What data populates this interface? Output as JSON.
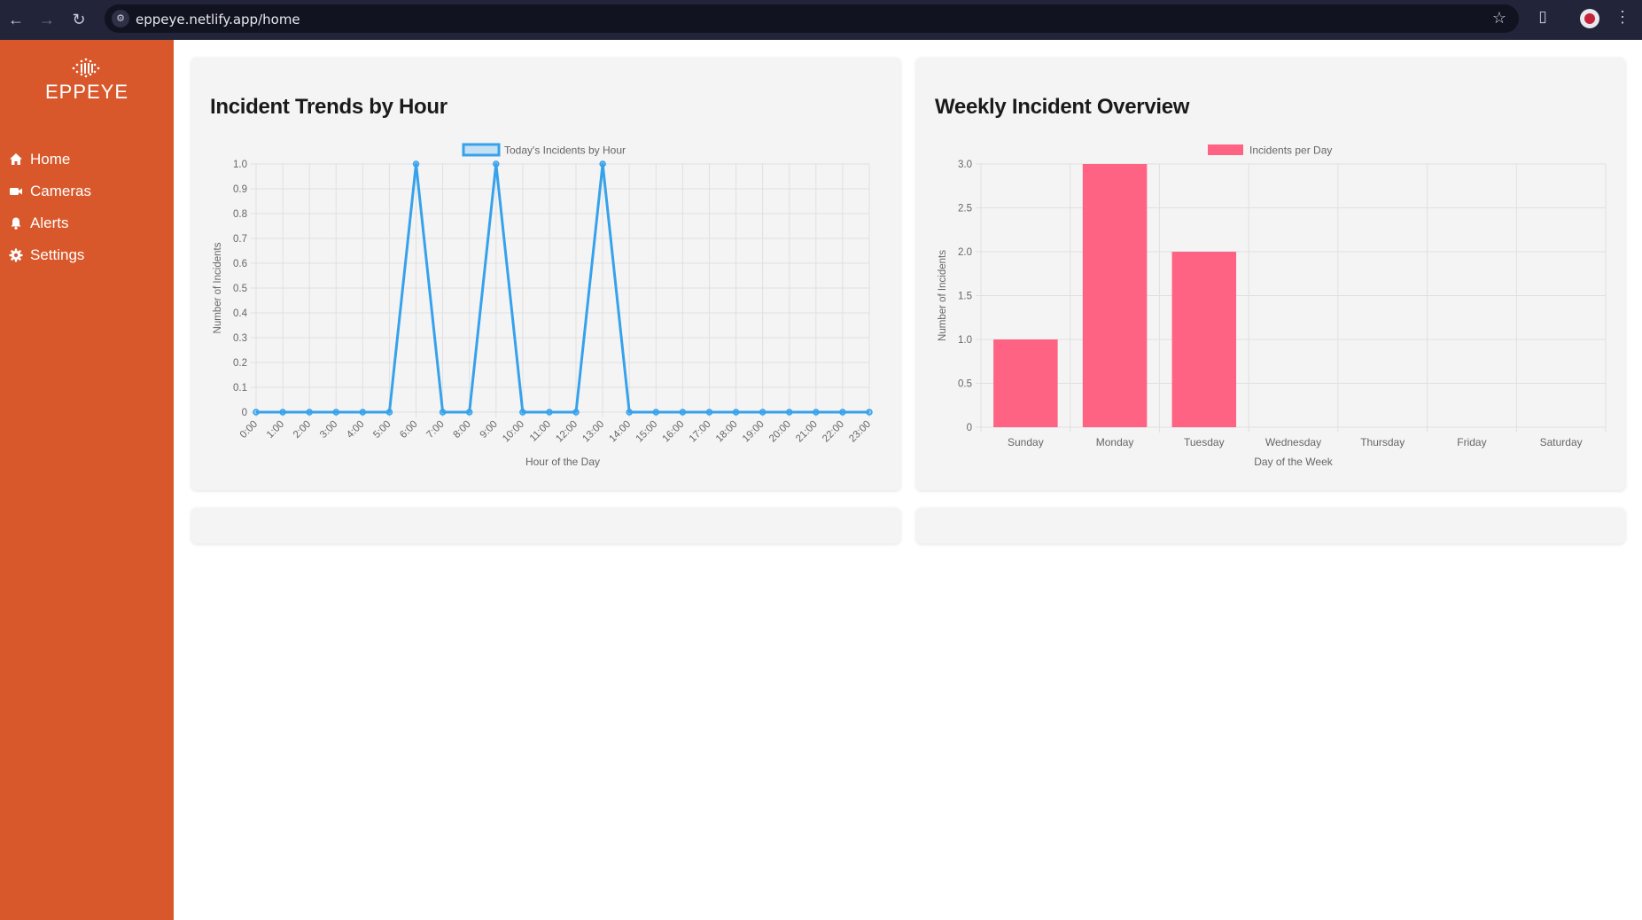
{
  "browser": {
    "url": "eppeye.netlify.app/home"
  },
  "sidebar": {
    "brand": "EPPEYE",
    "items": [
      {
        "label": "Home",
        "icon": "home-icon"
      },
      {
        "label": "Cameras",
        "icon": "camera-icon"
      },
      {
        "label": "Alerts",
        "icon": "bell-icon"
      },
      {
        "label": "Settings",
        "icon": "gear-icon"
      }
    ]
  },
  "colors": {
    "sidebar": "#d9582b",
    "line_series": "#36a2eb",
    "bar_series": "#ff6384"
  },
  "cards": {
    "hourly_title": "Incident Trends by Hour",
    "weekly_title": "Weekly Incident Overview"
  },
  "chart_data": [
    {
      "type": "line",
      "title": "Incident Trends by Hour",
      "legend": "Today's Incidents by Hour",
      "legend_position": "top",
      "xlabel": "Hour of the Day",
      "ylabel": "Number of Incidents",
      "categories": [
        "0:00",
        "1:00",
        "2:00",
        "3:00",
        "4:00",
        "5:00",
        "6:00",
        "7:00",
        "8:00",
        "9:00",
        "10:00",
        "11:00",
        "12:00",
        "13:00",
        "14:00",
        "15:00",
        "16:00",
        "17:00",
        "18:00",
        "19:00",
        "20:00",
        "21:00",
        "22:00",
        "23:00"
      ],
      "series": [
        {
          "name": "Today's Incidents by Hour",
          "values": [
            0,
            0,
            0,
            0,
            0,
            0,
            1,
            0,
            0,
            1,
            0,
            0,
            0,
            1,
            0,
            0,
            0,
            0,
            0,
            0,
            0,
            0,
            0,
            0
          ]
        }
      ],
      "ylim": [
        0,
        1
      ],
      "yticks": [
        "0",
        "0.1",
        "0.2",
        "0.3",
        "0.4",
        "0.5",
        "0.6",
        "0.7",
        "0.8",
        "0.9",
        "1.0"
      ],
      "grid": true
    },
    {
      "type": "bar",
      "title": "Weekly Incident Overview",
      "legend": "Incidents per Day",
      "legend_position": "top",
      "xlabel": "Day of the Week",
      "ylabel": "Number of Incidents",
      "categories": [
        "Sunday",
        "Monday",
        "Tuesday",
        "Wednesday",
        "Thursday",
        "Friday",
        "Saturday"
      ],
      "series": [
        {
          "name": "Incidents per Day",
          "values": [
            1,
            3,
            2,
            0,
            0,
            0,
            0
          ]
        }
      ],
      "ylim": [
        0,
        3
      ],
      "yticks": [
        "0",
        "0.5",
        "1.0",
        "1.5",
        "2.0",
        "2.5",
        "3.0"
      ],
      "grid": true
    }
  ]
}
